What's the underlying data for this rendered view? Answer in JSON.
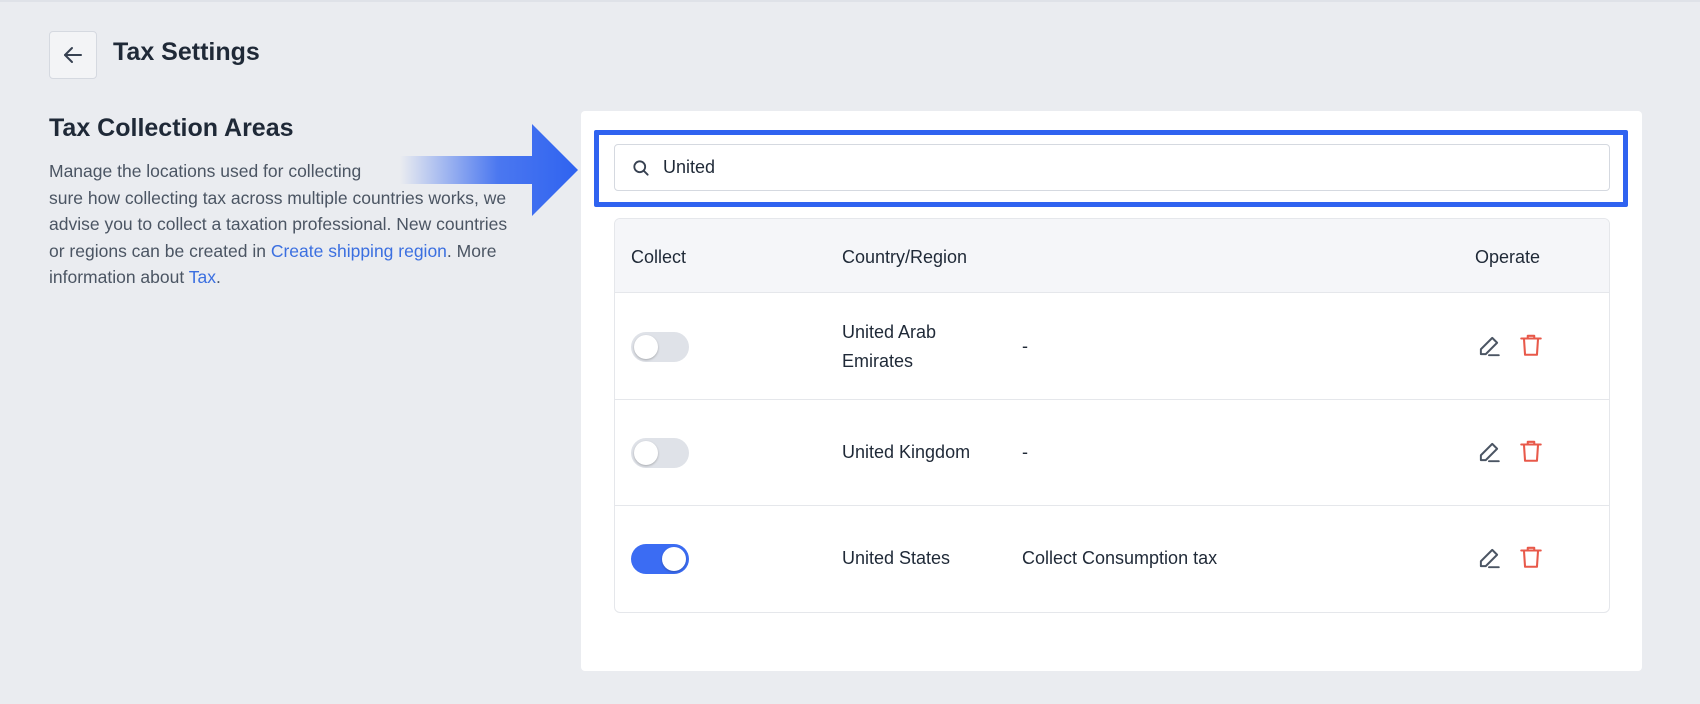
{
  "header": {
    "title": "Tax Settings"
  },
  "section": {
    "title": "Tax Collection Areas",
    "desc_part1": "Manage the locations used for collecting",
    "desc_part2": "sure how collecting tax across multiple countries works,",
    "desc_part2b": "we",
    "desc_part3": "advise you to collect a taxation professional. New countries",
    "desc_part4": "or regions can be created in",
    "link_shipping": "Create shipping region",
    "desc_part5": ". More",
    "desc_part6": "information about",
    "link_tax": "Tax",
    "desc_part7": "."
  },
  "search": {
    "value": "United"
  },
  "table": {
    "headers": {
      "collect": "Collect",
      "country": "Country/Region",
      "operate": "Operate"
    },
    "rows": [
      {
        "country_line1": "United Arab",
        "country_line2": "Emirates",
        "tax": "-",
        "collect": false
      },
      {
        "country_line1": "United Kingdom",
        "country_line2": "",
        "tax": "-",
        "collect": false
      },
      {
        "country_line1": "United States",
        "country_line2": "",
        "tax": "Collect Consumption tax",
        "collect": true
      }
    ]
  },
  "colors": {
    "accent": "#3b6cf3",
    "highlight": "#2f63f0",
    "delete": "#e8594a",
    "link": "#3b6fe0"
  },
  "icons": {
    "back": "arrow-left-icon",
    "search": "search-icon",
    "edit": "edit-icon",
    "delete": "trash-icon"
  }
}
